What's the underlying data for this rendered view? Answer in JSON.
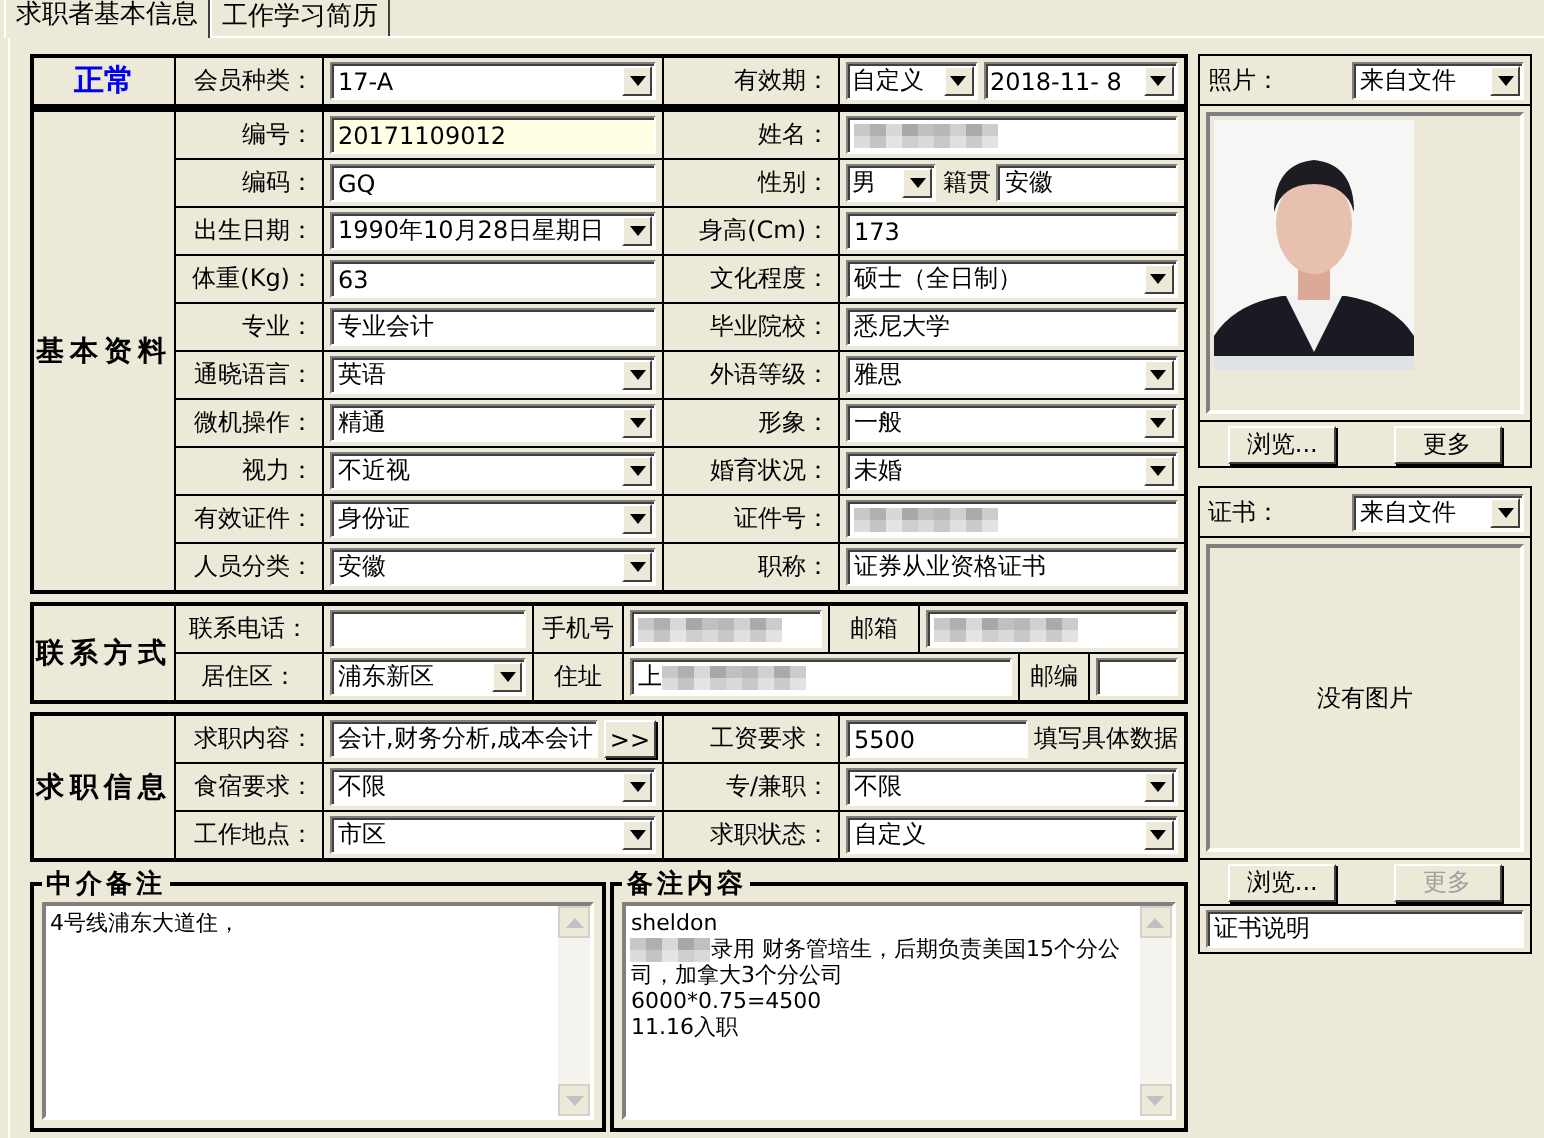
{
  "tabs": [
    {
      "label": "求职者基本信息",
      "selected": true
    },
    {
      "label": "工作学习简历",
      "selected": false
    }
  ],
  "status": "正常",
  "header_row": [
    {
      "kind": "label",
      "text": "会员种类："
    },
    {
      "kind": "combo",
      "value": "17-A"
    },
    {
      "kind": "label",
      "text": "有效期："
    },
    {
      "kind": "multi",
      "controls": [
        {
          "kind": "combo",
          "value": "自定义"
        },
        {
          "kind": "combo",
          "value": "2018-11- 8"
        }
      ]
    }
  ],
  "sections": [
    {
      "kind": "grid",
      "title": "基本资料",
      "rows": [
        [
          {
            "kind": "label",
            "text": "编号："
          },
          {
            "kind": "text",
            "value": "20171109012",
            "highlighted": true
          },
          {
            "kind": "label",
            "text": "姓名："
          },
          {
            "kind": "blurred"
          }
        ],
        [
          {
            "kind": "label",
            "text": "编码："
          },
          {
            "kind": "text",
            "value": "GQ"
          },
          {
            "kind": "label",
            "text": "性别："
          },
          {
            "kind": "multi",
            "controls": [
              {
                "kind": "combo",
                "value": "男"
              },
              {
                "kind": "label",
                "text": "籍贯"
              },
              {
                "kind": "text",
                "value": "安徽"
              }
            ]
          }
        ],
        [
          {
            "kind": "label",
            "text": "出生日期："
          },
          {
            "kind": "combo",
            "value": "1990年10月28日星期日"
          },
          {
            "kind": "label",
            "text": "身高(Cm)："
          },
          {
            "kind": "text",
            "value": "173"
          }
        ],
        [
          {
            "kind": "label",
            "text": "体重(Kg)："
          },
          {
            "kind": "text",
            "value": "63"
          },
          {
            "kind": "label",
            "text": "文化程度："
          },
          {
            "kind": "combo",
            "value": "硕士（全日制）"
          }
        ],
        [
          {
            "kind": "label",
            "text": "专业："
          },
          {
            "kind": "text",
            "value": "专业会计"
          },
          {
            "kind": "label",
            "text": "毕业院校："
          },
          {
            "kind": "text",
            "value": "悉尼大学"
          }
        ],
        [
          {
            "kind": "label",
            "text": "通晓语言："
          },
          {
            "kind": "combo",
            "value": "英语"
          },
          {
            "kind": "label",
            "text": "外语等级："
          },
          {
            "kind": "combo",
            "value": "雅思"
          }
        ],
        [
          {
            "kind": "label",
            "text": "微机操作："
          },
          {
            "kind": "combo",
            "value": "精通"
          },
          {
            "kind": "label",
            "text": "形象："
          },
          {
            "kind": "combo",
            "value": "一般"
          }
        ],
        [
          {
            "kind": "label",
            "text": "视力："
          },
          {
            "kind": "combo",
            "value": "不近视"
          },
          {
            "kind": "label",
            "text": "婚育状况："
          },
          {
            "kind": "combo",
            "value": "未婚"
          }
        ],
        [
          {
            "kind": "label",
            "text": "有效证件："
          },
          {
            "kind": "combo",
            "value": "身份证"
          },
          {
            "kind": "label",
            "text": "证件号："
          },
          {
            "kind": "blurred"
          }
        ],
        [
          {
            "kind": "label",
            "text": "人员分类："
          },
          {
            "kind": "combo",
            "value": "安徽"
          },
          {
            "kind": "label",
            "text": "职称："
          },
          {
            "kind": "text",
            "value": "证券从业资格证书"
          }
        ]
      ]
    },
    {
      "kind": "contact",
      "title": "联系方式",
      "rows": [
        [
          {
            "kind": "label",
            "text": "联系电话："
          },
          {
            "kind": "text"
          },
          {
            "kind": "label",
            "text": "手机号"
          },
          {
            "kind": "blurred"
          },
          {
            "kind": "label",
            "text": "邮箱"
          },
          {
            "kind": "blurred"
          }
        ],
        [
          {
            "kind": "label",
            "text": "居住区："
          },
          {
            "kind": "combo",
            "value": "浦东新区"
          },
          {
            "kind": "label",
            "text": "住址"
          },
          {
            "kind": "blurred",
            "value": "上"
          },
          {
            "kind": "label",
            "text": "邮编"
          },
          {
            "kind": "text"
          }
        ]
      ]
    },
    {
      "kind": "grid",
      "title": "求职信息",
      "rows": [
        [
          {
            "kind": "label",
            "text": "求职内容："
          },
          {
            "kind": "multi",
            "controls": [
              {
                "kind": "text",
                "value": "会计,财务分析,成本会计"
              },
              {
                "kind": "button",
                "label": ">>"
              }
            ]
          },
          {
            "kind": "label",
            "text": "工资要求："
          },
          {
            "kind": "multi",
            "controls": [
              {
                "kind": "text",
                "value": "5500"
              },
              {
                "kind": "label",
                "text": "填写具体数据"
              }
            ]
          }
        ],
        [
          {
            "kind": "label",
            "text": "食宿要求："
          },
          {
            "kind": "combo",
            "value": "不限"
          },
          {
            "kind": "label",
            "text": "专/兼职："
          },
          {
            "kind": "combo",
            "value": "不限"
          }
        ],
        [
          {
            "kind": "label",
            "text": "工作地点："
          },
          {
            "kind": "combo",
            "value": "市区"
          },
          {
            "kind": "label",
            "text": "求职状态："
          },
          {
            "kind": "combo",
            "value": "自定义"
          }
        ]
      ]
    }
  ],
  "notes": [
    {
      "title": "中介备注",
      "lines": [
        {
          "text": "4号线浦东大道住，"
        }
      ]
    },
    {
      "title": "备注内容",
      "lines": [
        {
          "text": "sheldon"
        },
        {
          "text": "录用 财务管培生，后期负责美国15个分公",
          "blurred_prefix": true
        },
        {
          "text": "司，加拿大3个分公司"
        },
        {
          "text": "6000*0.75=4500"
        },
        {
          "text": "11.16入职"
        }
      ]
    }
  ],
  "photo_panel": {
    "label": "照片：",
    "source": "来自文件",
    "buttons": [
      {
        "label": "浏览...",
        "disabled": false
      },
      {
        "label": "更多",
        "disabled": false
      }
    ]
  },
  "certificate_panel": {
    "label": "证书：",
    "source": "来自文件",
    "content": {
      "kind": "empty",
      "text": "没有图片"
    },
    "buttons": [
      {
        "label": "浏览...",
        "disabled": false
      },
      {
        "label": "更多",
        "disabled": true
      }
    ],
    "caption": "证书说明"
  }
}
